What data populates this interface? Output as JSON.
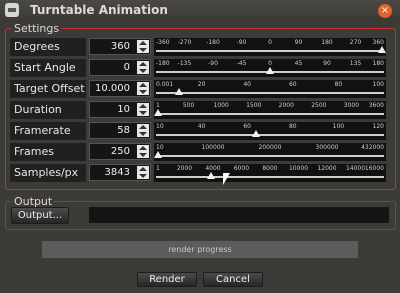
{
  "window": {
    "title": "Turntable Animation",
    "close_symbol": "×"
  },
  "settings": {
    "label": "Settings",
    "rows": [
      {
        "label": "Degrees",
        "value": "360",
        "ticks": [
          "-360",
          "-270",
          "-180",
          "-90",
          "0",
          "90",
          "180",
          "270",
          "360"
        ],
        "slider_fraction": 1.0
      },
      {
        "label": "Start Angle",
        "value": "0",
        "ticks": [
          "-180",
          "-135",
          "-90",
          "-45",
          "0",
          "45",
          "90",
          "135",
          "180"
        ],
        "slider_fraction": 0.5
      },
      {
        "label": "Target Offset",
        "value": "10.000",
        "ticks": [
          "0.001",
          "20",
          "40",
          "60",
          "80",
          "100"
        ],
        "slider_fraction": 0.1
      },
      {
        "label": "Duration",
        "value": "10",
        "ticks": [
          "1",
          "500",
          "1000",
          "1500",
          "2000",
          "2500",
          "3000",
          "3600"
        ],
        "slider_fraction": 0.0
      },
      {
        "label": "Framerate",
        "value": "58",
        "ticks": [
          "10",
          "40",
          "60",
          "80",
          "100",
          "120"
        ],
        "slider_fraction": 0.44
      },
      {
        "label": "Frames",
        "value": "250",
        "ticks": [
          "10",
          "100000",
          "200000",
          "300000",
          "432000"
        ],
        "slider_fraction": 0.0
      },
      {
        "label": "Samples/px",
        "value": "3843",
        "ticks": [
          "1",
          "2000",
          "4000",
          "6000",
          "8000",
          "10000",
          "12000",
          "14000",
          "16000"
        ],
        "slider_fraction": 0.24
      }
    ]
  },
  "output": {
    "label": "Output",
    "button_label": "Output...",
    "path_value": ""
  },
  "progress": {
    "text": "render progress"
  },
  "actions": {
    "render_label": "Render",
    "cancel_label": "Cancel"
  }
}
